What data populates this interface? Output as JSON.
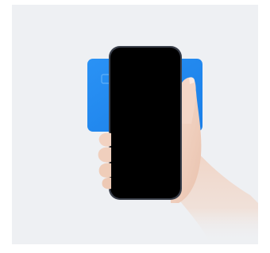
{
  "scene": {
    "background_color": "#eef0f3",
    "card_color": "#1e88f0",
    "phone_screen_color": "#000000",
    "phone_frame_color": "#3a3f4a",
    "skin_color": "#f1d2c2"
  },
  "icons": {
    "card": "credit-card-icon",
    "phone": "smartphone-icon",
    "hand": "hand-icon"
  }
}
